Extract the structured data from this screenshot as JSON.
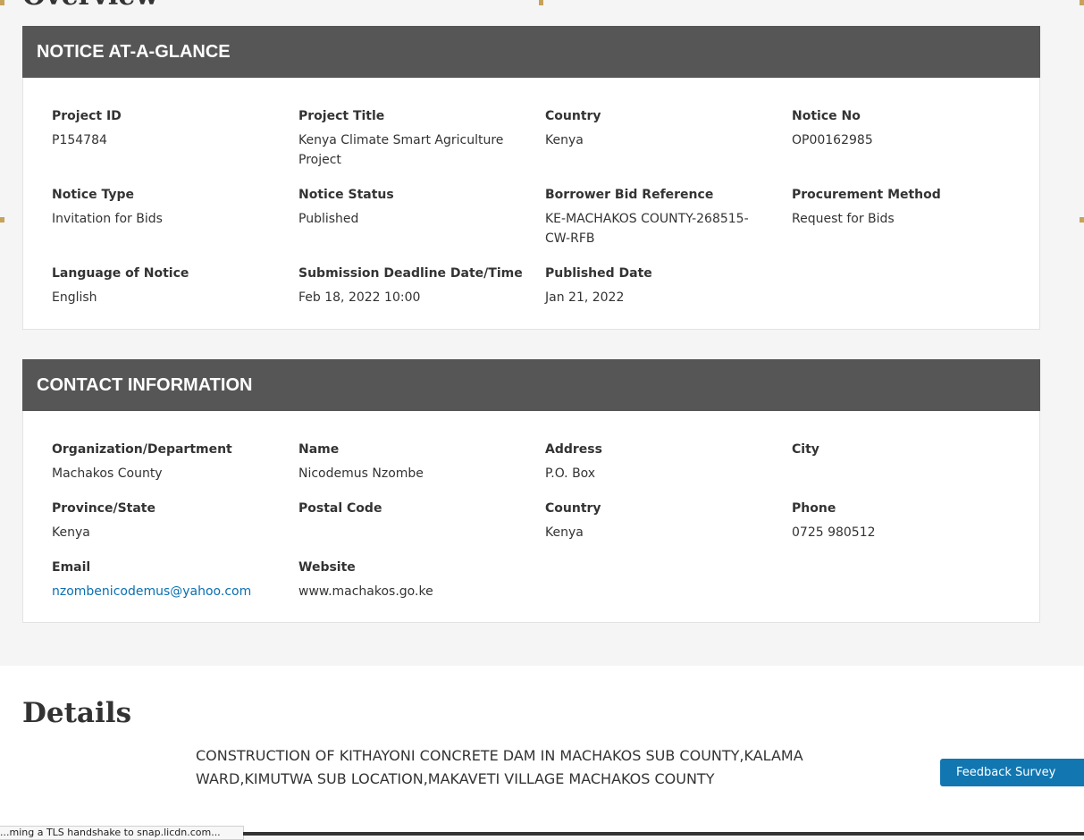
{
  "overview": {
    "title": "Overview"
  },
  "notice": {
    "header": "NOTICE AT-A-GLANCE",
    "fields": [
      {
        "label": "Project ID",
        "value": "P154784"
      },
      {
        "label": "Project Title",
        "value": "Kenya Climate Smart Agriculture Project"
      },
      {
        "label": "Country",
        "value": "Kenya"
      },
      {
        "label": "Notice No",
        "value": "OP00162985"
      },
      {
        "label": "Notice Type",
        "value": "Invitation for Bids"
      },
      {
        "label": "Notice Status",
        "value": "Published"
      },
      {
        "label": "Borrower Bid Reference",
        "value": "KE-MACHAKOS COUNTY-268515-CW-RFB"
      },
      {
        "label": "Procurement Method",
        "value": "Request for Bids"
      },
      {
        "label": "Language of Notice",
        "value": "English"
      },
      {
        "label": "Submission Deadline Date/Time",
        "value": "Feb 18, 2022 10:00"
      },
      {
        "label": "Published Date",
        "value": "Jan 21, 2022"
      }
    ]
  },
  "contact": {
    "header": "CONTACT INFORMATION",
    "fields": [
      {
        "label": "Organization/Department",
        "value": "Machakos County"
      },
      {
        "label": "Name",
        "value": "Nicodemus Nzombe"
      },
      {
        "label": "Address",
        "value": "P.O. Box"
      },
      {
        "label": "City",
        "value": ""
      },
      {
        "label": "Province/State",
        "value": "Kenya"
      },
      {
        "label": "Postal Code",
        "value": ""
      },
      {
        "label": "Country",
        "value": "Kenya"
      },
      {
        "label": "Phone",
        "value": "0725 980512"
      },
      {
        "label": "Email",
        "value": "nzombenicodemus@yahoo.com"
      },
      {
        "label": "Website",
        "value": "www.machakos.go.ke"
      }
    ]
  },
  "details": {
    "title": "Details",
    "text": "CONSTRUCTION OF KITHAYONI CONCRETE DAM IN MACHAKOS SUB COUNTY,KALAMA WARD,KIMUTWA SUB LOCATION,MAKAVETI VILLAGE MACHAKOS COUNTY"
  },
  "feedback": {
    "label": "Feedback Survey"
  },
  "status_bar": {
    "text": "...ming a TLS handshake to snap.licdn.com..."
  },
  "colors": {
    "header_bg": "#565656",
    "link": "#0a6fb1",
    "button": "#1277b1"
  }
}
